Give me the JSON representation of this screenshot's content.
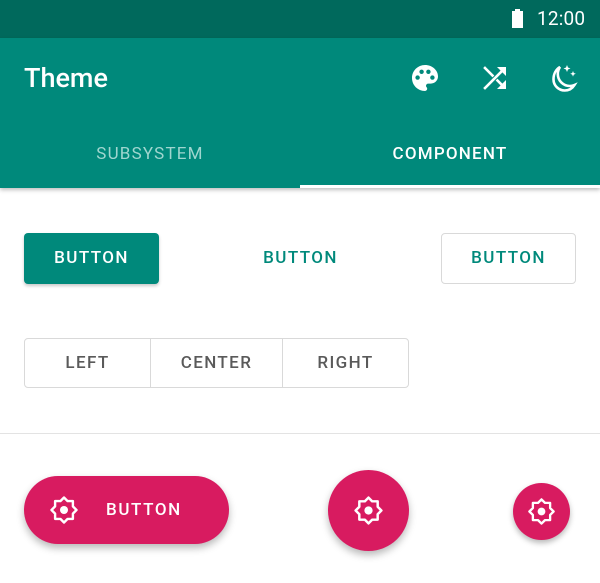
{
  "status_bar": {
    "time": "12:00",
    "battery_icon": "battery-full-icon",
    "background": "#00695c"
  },
  "app_bar": {
    "title": "Theme",
    "background": "#00897b",
    "actions": [
      {
        "name": "palette",
        "icon": "palette-icon"
      },
      {
        "name": "shuffle",
        "icon": "shuffle-icon"
      },
      {
        "name": "dark-mode",
        "icon": "night-mode-icon"
      }
    ]
  },
  "tabs": {
    "items": [
      {
        "label": "SUBSYSTEM",
        "selected": false
      },
      {
        "label": "COMPONENT",
        "selected": true
      }
    ]
  },
  "buttons": {
    "contained_label": "BUTTON",
    "text_label": "BUTTON",
    "outlined_label": "BUTTON",
    "primary_color": "#00897b"
  },
  "toggle_group": {
    "options": [
      "LEFT",
      "CENTER",
      "RIGHT"
    ]
  },
  "fabs": {
    "accent_color": "#d81b60",
    "extended_label": "BUTTON",
    "icon": "brightness-icon"
  }
}
